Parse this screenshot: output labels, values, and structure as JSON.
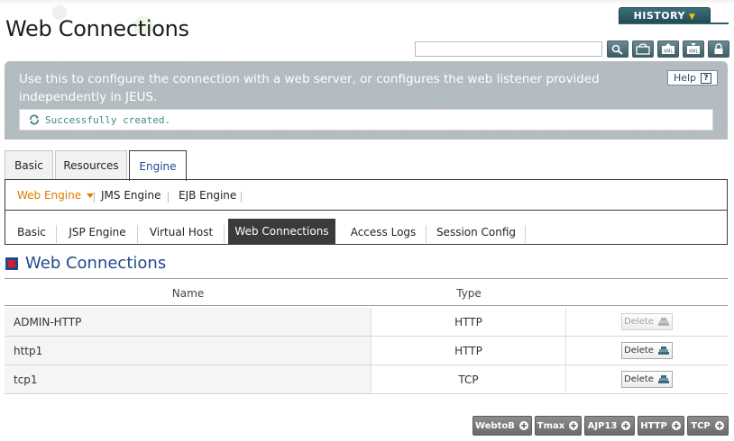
{
  "header": {
    "title": "Web Connections",
    "history_label": "HISTORY",
    "search": {
      "value": "",
      "placeholder": ""
    },
    "toolbar_icons": [
      "search-icon",
      "refresh-icon",
      "xml-export-icon",
      "xml-import-icon",
      "lock-icon"
    ]
  },
  "banner": {
    "description": "Use this to configure the connection with a web server, or configures the web listener provided independently in JEUS.",
    "help_label": "Help",
    "status_message": "Successfully created."
  },
  "main_tabs": [
    {
      "label": "Basic",
      "active": false
    },
    {
      "label": "Resources",
      "active": false
    },
    {
      "label": "Engine",
      "active": true
    }
  ],
  "engine_tabs": [
    {
      "label": "Web Engine",
      "active": true
    },
    {
      "label": "JMS Engine",
      "active": false
    },
    {
      "label": "EJB Engine",
      "active": false
    }
  ],
  "web_tabs": [
    {
      "label": "Basic",
      "active": false
    },
    {
      "label": "JSP Engine",
      "active": false
    },
    {
      "label": "Virtual Host",
      "active": false
    },
    {
      "label": "Web Connections",
      "active": true
    },
    {
      "label": "Access Logs",
      "active": false
    },
    {
      "label": "Session Config",
      "active": false
    }
  ],
  "section": {
    "title": "Web Connections"
  },
  "table": {
    "columns": [
      "Name",
      "Type"
    ],
    "rows": [
      {
        "name": "ADMIN-HTTP",
        "type": "HTTP",
        "action": "Delete",
        "disabled": true
      },
      {
        "name": "http1",
        "type": "HTTP",
        "action": "Delete",
        "disabled": false
      },
      {
        "name": "tcp1",
        "type": "TCP",
        "action": "Delete",
        "disabled": false
      }
    ]
  },
  "add_buttons": [
    "WebtoB",
    "Tmax",
    "AJP13",
    "HTTP",
    "TCP"
  ],
  "colors": {
    "accent_blue": "#1f4b8c",
    "active_orange": "#e07a00",
    "status_teal": "#3d8b88",
    "banner_gray": "#b3bcc1"
  }
}
